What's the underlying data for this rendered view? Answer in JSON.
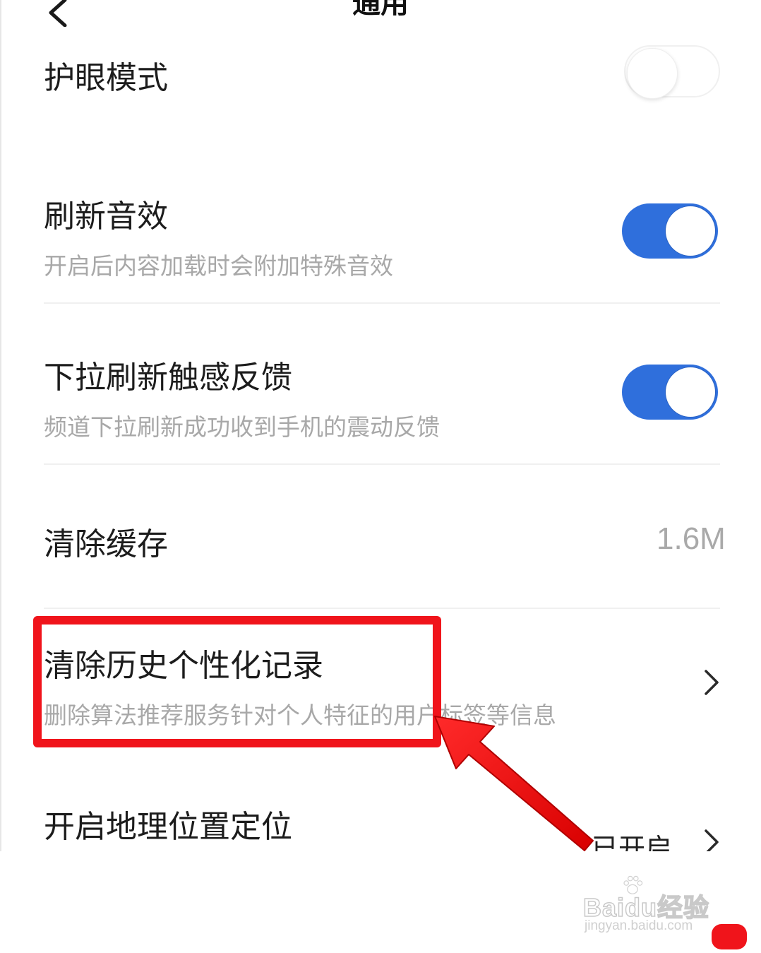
{
  "header": {
    "title": "通用",
    "back_icon": "chevron-left-icon"
  },
  "settings": [
    {
      "id": "eye-protection",
      "title": "护眼模式",
      "subtitle": "",
      "control": "toggle",
      "state": "off"
    },
    {
      "id": "refresh-sound",
      "title": "刷新音效",
      "subtitle": "开启后内容加载时会附加特殊音效",
      "control": "toggle",
      "state": "on"
    },
    {
      "id": "pull-haptic",
      "title": "下拉刷新触感反馈",
      "subtitle": "频道下拉刷新成功收到手机的震动反馈",
      "control": "toggle",
      "state": "on"
    },
    {
      "id": "clear-cache",
      "title": "清除缓存",
      "subtitle": "",
      "control": "value",
      "value": "1.6M"
    },
    {
      "id": "clear-history",
      "title": "清除历史个性化记录",
      "subtitle": "删除算法推荐服务针对个人特征的用户标签等信息",
      "control": "chevron"
    },
    {
      "id": "location",
      "title": "开启地理位置定位",
      "subtitle": "",
      "control": "value-chevron",
      "value": "已开启"
    }
  ],
  "colors": {
    "toggle_on": "#2f6fdc",
    "annotation_red": "#f0141b",
    "subtitle_gray": "#a8a8a8"
  },
  "watermark": {
    "brand": "Baidu经验",
    "url": "jingyan.baidu.com",
    "icon": "paw-icon"
  }
}
